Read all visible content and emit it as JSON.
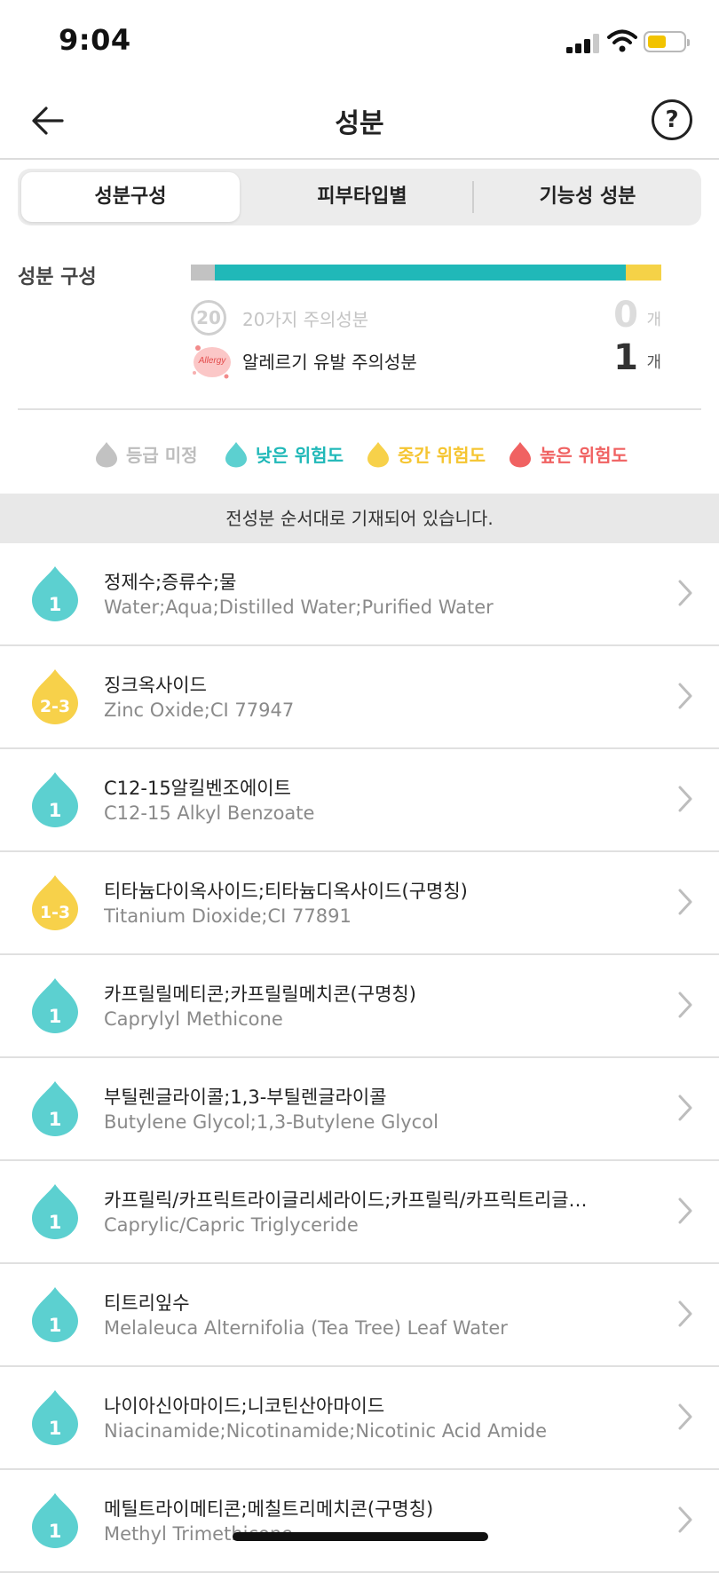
{
  "status_bar": {
    "time": "9:04",
    "battery_color": "#f2c300"
  },
  "nav": {
    "title": "성분",
    "back_icon": "arrow-left-icon",
    "help_icon": "question-circle-icon",
    "help_glyph": "?"
  },
  "tabs": [
    {
      "label": "성분구성",
      "active": true
    },
    {
      "label": "피부타입별",
      "active": false
    },
    {
      "label": "기능성 성분",
      "active": false
    }
  ],
  "composition": {
    "label": "성분 구성",
    "bar": [
      {
        "level": "grade-unknown",
        "fraction": 0.05,
        "color": "#c2c2c2"
      },
      {
        "level": "low",
        "fraction": 0.875,
        "color": "#20b8b8"
      },
      {
        "level": "medium",
        "fraction": 0.075,
        "color": "#f5d247"
      }
    ],
    "warnings": [
      {
        "icon": "twenty-warning-icon",
        "icon_text": "20",
        "text": "20가지 주의성분",
        "count": "0",
        "unit": "개",
        "active": false
      },
      {
        "icon": "allergy-icon",
        "icon_text": "Allergy",
        "text": "알레르기 유발 주의성분",
        "count": "1",
        "unit": "개",
        "active": true
      }
    ]
  },
  "legend": [
    {
      "label": "등급 미정",
      "color": "#c2c2c2"
    },
    {
      "label": "낮은 위험도",
      "color": "#20b8b8"
    },
    {
      "label": "중간 위험도",
      "color": "#f5c531"
    },
    {
      "label": "높은 위험도",
      "color": "#f06262"
    }
  ],
  "notice": "전성분 순서대로 기재되어 있습니다.",
  "ingredients": [
    {
      "grade": "1",
      "level": "low",
      "ko": "정제수;증류수;물",
      "en": "Water;Aqua;Distilled Water;Purified Water"
    },
    {
      "grade": "2-3",
      "level": "medium",
      "ko": "징크옥사이드",
      "en": "Zinc Oxide;CI 77947"
    },
    {
      "grade": "1",
      "level": "low",
      "ko": "C12-15알킬벤조에이트",
      "en": "C12-15 Alkyl Benzoate"
    },
    {
      "grade": "1-3",
      "level": "medium",
      "ko": "티타늄다이옥사이드;티타늄디옥사이드(구명칭)",
      "en": "Titanium Dioxide;CI 77891"
    },
    {
      "grade": "1",
      "level": "low",
      "ko": "카프릴릴메티콘;카프릴릴메치콘(구명칭)",
      "en": "Caprylyl Methicone"
    },
    {
      "grade": "1",
      "level": "low",
      "ko": "부틸렌글라이콜;1,3-부틸렌글라이콜",
      "en": "Butylene Glycol;1,3-Butylene Glycol"
    },
    {
      "grade": "1",
      "level": "low",
      "ko": "카프릴릭/카프릭트라이글리세라이드;카프릴릭/카프릭트리글…",
      "en": "Caprylic/Capric Triglyceride"
    },
    {
      "grade": "1",
      "level": "low",
      "ko": "티트리잎수",
      "en": "Melaleuca Alternifolia (Tea Tree) Leaf Water"
    },
    {
      "grade": "1",
      "level": "low",
      "ko": "나이아신아마이드;니코틴산아마이드",
      "en": "Niacinamide;Nicotinamide;Nicotinic Acid Amide"
    },
    {
      "grade": "1",
      "level": "low",
      "ko": "메틸트라이메티콘;메칠트리메치콘(구명칭)",
      "en": "Methyl Trimethicone"
    }
  ],
  "colors": {
    "low": "#5cd0d0",
    "medium": "#f7d14a",
    "unknown": "#c2c2c2",
    "high": "#f06262"
  }
}
